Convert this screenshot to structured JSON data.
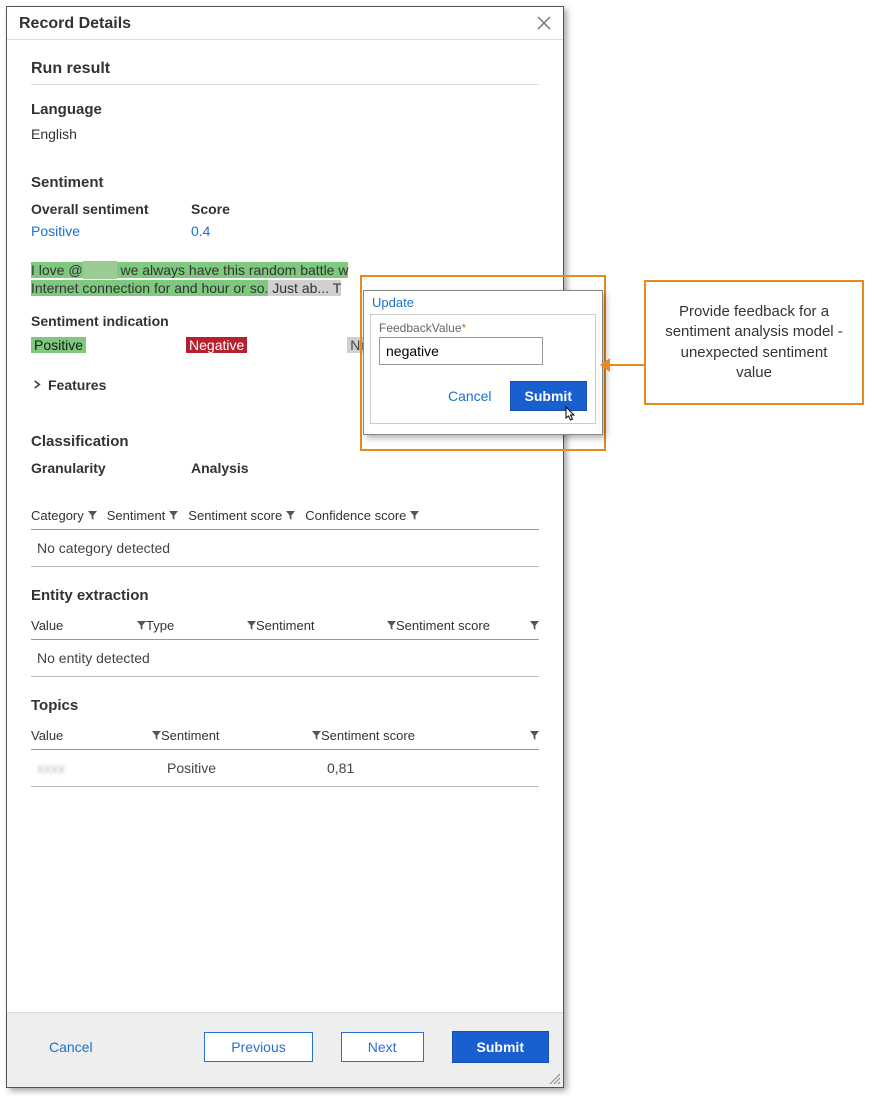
{
  "dialog": {
    "title": "Record Details",
    "run_result_heading": "Run result",
    "language_heading": "Language",
    "language_value": "English",
    "sentiment_heading": "Sentiment",
    "overall_sentiment_label": "Overall sentiment",
    "score_label": "Score",
    "overall_sentiment_value": "Positive",
    "score_value": "0.4",
    "sample_text": {
      "pos_prefix": "I love @",
      "redacted": "XXXX",
      "pos_suffix": " we always have this random battle w",
      "pos_line2": "Internet connection for and hour or so.",
      "neu_part": " Just ab...  T"
    },
    "sentiment_indication_label": "Sentiment indication",
    "legend_positive": "Positive",
    "legend_negative": "Negative",
    "legend_neutral": "Neutral",
    "features_label": "Features",
    "classification_heading": "Classification",
    "granularity_label": "Granularity",
    "analysis_label": "Analysis",
    "class_table": {
      "headers": [
        "Category",
        "Sentiment",
        "Sentiment score",
        "Confidence score"
      ],
      "empty_text": "No category detected"
    },
    "entity_heading": "Entity extraction",
    "entity_table": {
      "headers": [
        "Value",
        "Type",
        "Sentiment",
        "Sentiment score"
      ],
      "empty_text": "No entity detected"
    },
    "topics_heading": "Topics",
    "topics_table": {
      "headers": [
        "Value",
        "Sentiment",
        "Sentiment score"
      ],
      "row": {
        "value": "xxxx",
        "sentiment": "Positive",
        "score": "0,81"
      }
    }
  },
  "footer": {
    "cancel": "Cancel",
    "previous": "Previous",
    "next": "Next",
    "submit": "Submit"
  },
  "popup": {
    "title": "Update",
    "field_label": "FeedbackValue",
    "asterisk": "*",
    "value": "negative",
    "cancel": "Cancel",
    "submit": "Submit"
  },
  "callout_text": "Provide feedback for a sentiment analysis model - unexpected sentiment value"
}
